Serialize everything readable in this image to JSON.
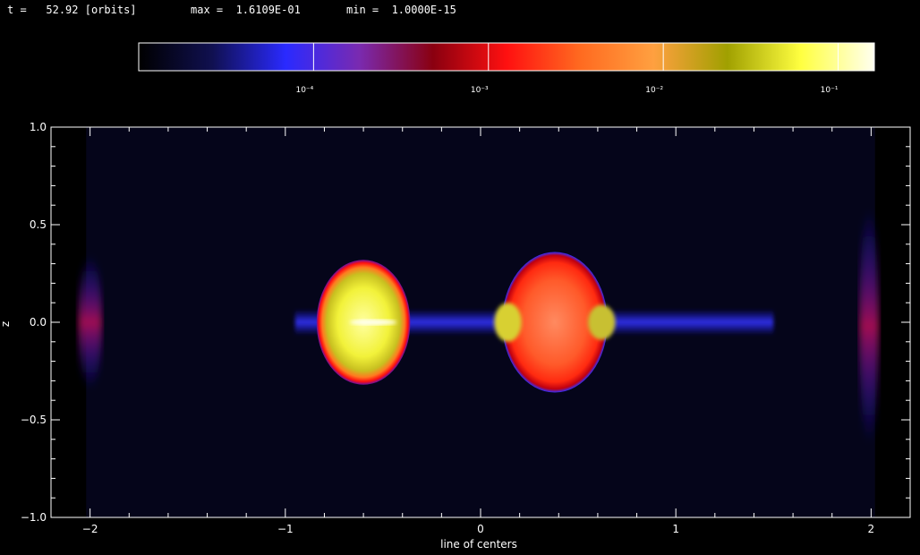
{
  "header": {
    "time_label": "t =",
    "time_value": "52.92",
    "time_unit": "[orbits]",
    "max_label": "max =",
    "max_value": "1.6109E-01",
    "min_label": "min =",
    "min_value": "1.0000E-15"
  },
  "colorbar": {
    "scale": "log",
    "range": [
      1e-05,
      0.16109
    ],
    "ticks": [
      {
        "value": 0.0001,
        "label": "10⁻⁴"
      },
      {
        "value": 0.001,
        "label": "10⁻³"
      },
      {
        "value": 0.01,
        "label": "10⁻²"
      },
      {
        "value": 0.1,
        "label": "10⁻¹"
      }
    ],
    "colors": [
      "#000000",
      "#101050",
      "#2a2aff",
      "#7a2ab0",
      "#8a0010",
      "#ff1010",
      "#ff6a20",
      "#ffa040",
      "#a0a000",
      "#ffff40",
      "#fffff0"
    ]
  },
  "chart_data": {
    "type": "heatmap",
    "xlabel": "line of centers",
    "ylabel": "z",
    "xlim": [
      -2.2,
      2.2
    ],
    "ylim": [
      -1.0,
      1.0
    ],
    "xticks": [
      -2,
      -1,
      0,
      1,
      2
    ],
    "xtick_labels": [
      "−2",
      "−1",
      "0",
      "1",
      "2"
    ],
    "yticks": [
      -1.0,
      -0.5,
      0.0,
      0.5,
      1.0
    ],
    "ytick_labels": [
      "−1.0",
      "−0.5",
      "0.0",
      "0.5",
      "1.0"
    ],
    "field_min": 1e-15,
    "field_max": 0.16109,
    "background_color": "#05051a",
    "features": [
      {
        "name": "primary-star",
        "center": [
          -0.6,
          0.0
        ],
        "radius_x": 0.24,
        "radius_z": 0.32
      },
      {
        "name": "secondary-star",
        "center": [
          0.38,
          0.0
        ],
        "radius_x": 0.27,
        "radius_z": 0.36
      },
      {
        "name": "accretion-stream",
        "x_range": [
          -0.95,
          1.5
        ],
        "z_halfwidth": 0.03
      }
    ]
  }
}
